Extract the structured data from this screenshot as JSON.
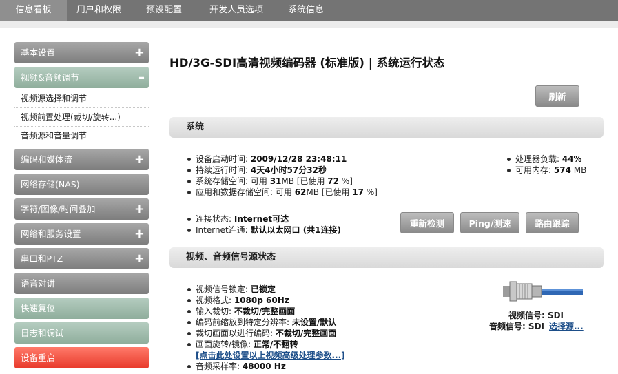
{
  "nav": {
    "tabs": [
      {
        "label": "信息看板"
      },
      {
        "label": "用户和权限"
      },
      {
        "label": "预设配置"
      },
      {
        "label": "开发人员选项"
      },
      {
        "label": "系统信息"
      }
    ]
  },
  "sidebar": {
    "items": [
      {
        "label": "基本设置",
        "toggle": "+"
      },
      {
        "label": "视频&音频调节",
        "toggle": "–"
      },
      {
        "label": "编码和媒体流",
        "toggle": "+"
      },
      {
        "label": "网络存储(NAS)",
        "toggle": ""
      },
      {
        "label": "字符/图像/时间叠加",
        "toggle": "+"
      },
      {
        "label": "网络和服务设置",
        "toggle": "+"
      },
      {
        "label": "串口和PTZ",
        "toggle": "+"
      },
      {
        "label": "语音对讲",
        "toggle": ""
      },
      {
        "label": "快速复位",
        "toggle": ""
      },
      {
        "label": "日志和调试",
        "toggle": ""
      },
      {
        "label": "设备重启",
        "toggle": ""
      }
    ],
    "subitems": [
      {
        "label": "视频源选择和调节"
      },
      {
        "label": "视频前置处理(裁切/旋转...)"
      },
      {
        "label": "音频源和音量调节"
      }
    ]
  },
  "page": {
    "title": "HD/3G-SDI高清视频编码器 (标准版) | 系统运行状态",
    "refresh_button": "刷新"
  },
  "system": {
    "header": "系统",
    "items": [
      {
        "label": "设备启动时间: ",
        "value": "2009/12/28 23:48:11",
        "suffix": ""
      },
      {
        "label": "持续运行时间: ",
        "value": "4天4小时57分32秒",
        "suffix": ""
      },
      {
        "label": "系统存储空间: 可用 ",
        "value": "31",
        "suffix": "MB [已使用 ",
        "value2": "72",
        "suffix2": " %]"
      },
      {
        "label": "应用和数据存储空间: 可用 ",
        "value": "62",
        "suffix": "MB [已使用 ",
        "value2": "17",
        "suffix2": " %]"
      }
    ],
    "right_items": [
      {
        "label": "处理器负载: ",
        "value": "44%",
        "suffix": ""
      },
      {
        "label": "可用内存: ",
        "value": "574",
        "suffix": " MB"
      }
    ],
    "conn_items": [
      {
        "label": "连接状态: ",
        "value": "Internet可达"
      },
      {
        "label": "Internet连通: ",
        "value": "默认以太网口 (共1连接)"
      }
    ],
    "buttons": {
      "recheck": "重新检测",
      "ping": "Ping/测速",
      "trace": "路由跟踪"
    }
  },
  "av": {
    "header": "视频、音频信号源状态",
    "items": [
      {
        "label": "视频信号锁定: ",
        "value": "已锁定"
      },
      {
        "label": "视频格式: ",
        "value": "1080p 60Hz"
      },
      {
        "label": "输入裁切:  ",
        "value": "不裁切/完整画面"
      },
      {
        "label": "编码前缩放到特定分辨率:  ",
        "value": "未设置/默认"
      },
      {
        "label": "裁切画面以进行编码:  ",
        "value": "不裁切/完整画面"
      },
      {
        "label": "画面旋转/镜像:  ",
        "value": "正常/不翻转"
      }
    ],
    "advanced_link": "[点击此处设置以上视频高级处理参数...]",
    "sample_rate": {
      "label": "音频采样率: ",
      "value": "48000 Hz"
    },
    "video_signal": "视频信号: SDI",
    "audio_signal": "音频信号: SDI",
    "select_source": "选择源..."
  },
  "colors": {
    "nav_bg": "#747474",
    "sidebar_gray": "#8f8f8f",
    "sidebar_green": "#9fbcab",
    "sidebar_red": "#f04a3b",
    "link": "#1d4e89"
  }
}
